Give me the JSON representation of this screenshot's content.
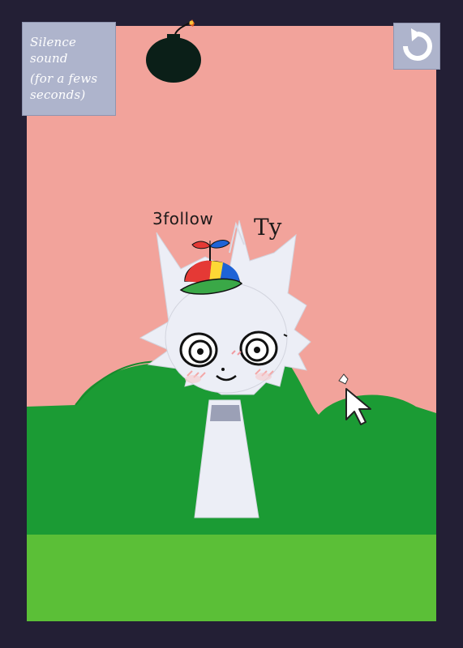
{
  "game": {
    "silence_button": {
      "line1": "Silence sound",
      "line2": "(for a fews seconds)"
    },
    "reset_icon": "reset-arrow-icon",
    "bomb_icon": "bomb-icon",
    "character_note": "3follow",
    "character_note_2": "Ty"
  },
  "colors": {
    "frame": "#231f35",
    "sky": "#f2a39b",
    "bush": "#1b9b34",
    "grass": "#5bbf37",
    "button": "#aeb4cc",
    "character": "#eceef6"
  }
}
